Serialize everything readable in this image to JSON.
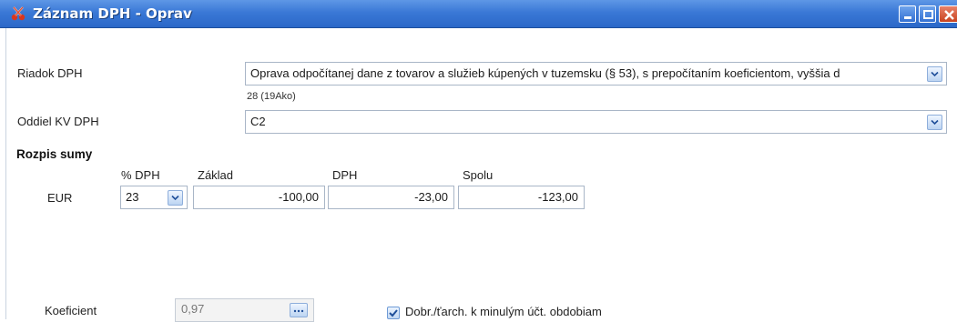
{
  "window": {
    "title": "Záznam DPH - Oprav",
    "icon": "scissors-icon",
    "controls": [
      "minimize-icon",
      "maximize-icon",
      "close-icon"
    ]
  },
  "form": {
    "riadok_label": "Riadok DPH",
    "riadok_value": "Oprava odpočítanej dane z tovarov a služieb kúpených v tuzemsku (§ 53), s prepočítaním koeficientom, vyššia d",
    "riadok_hint": "28 (19Ako)",
    "oddiel_label": "Oddiel KV DPH",
    "oddiel_value": "C2"
  },
  "rozpis": {
    "title": "Rozpis sumy",
    "currency": "EUR",
    "col_pct": "% DPH",
    "col_zaklad": "Základ",
    "col_dph": "DPH",
    "col_spolu": "Spolu",
    "pct_value": "23",
    "zaklad_value": "-100,00",
    "dph_value": "-23,00",
    "spolu_value": "-123,00"
  },
  "bottom": {
    "koef_label": "Koeficient",
    "koef_value": "0,97",
    "koef_button": "...",
    "checkbox_label": "Dobr./ťarch. k minulým účt. obdobiam",
    "checkbox_checked": true
  },
  "colors": {
    "titlebar": "#3a78d6",
    "title_text": "#ffffff",
    "close": "#c8431f"
  }
}
